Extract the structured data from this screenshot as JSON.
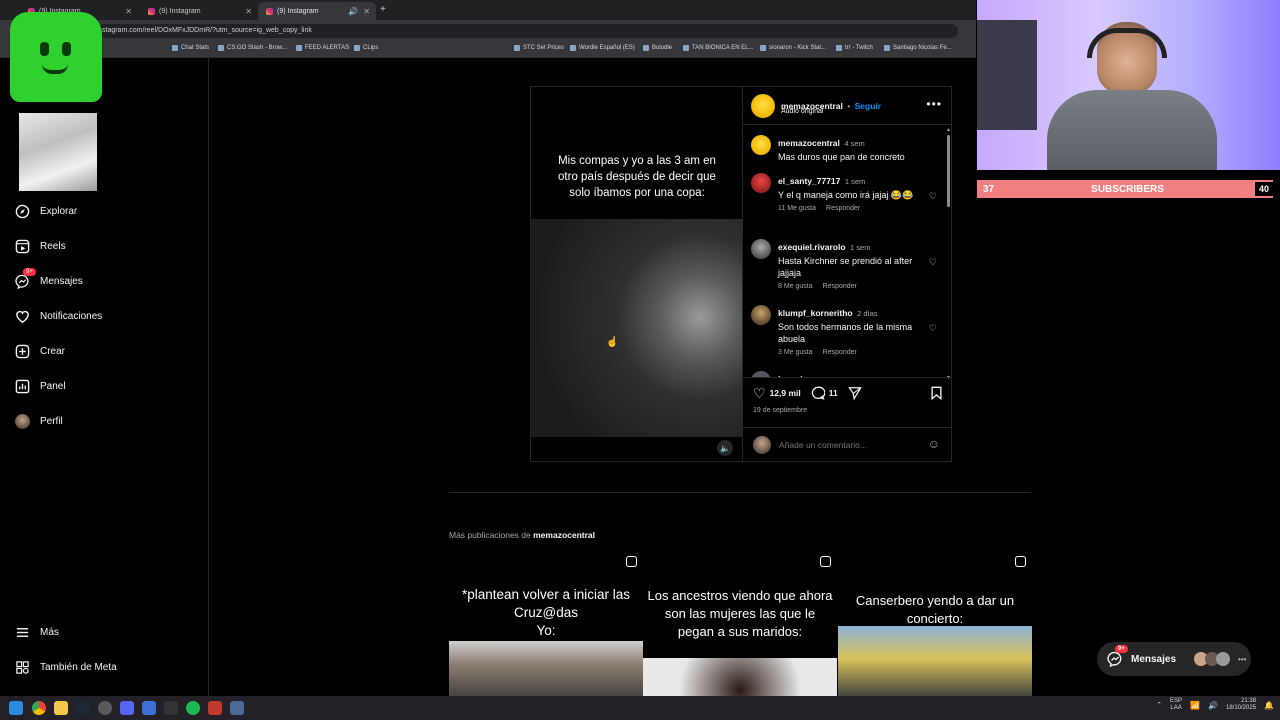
{
  "browser": {
    "tabs": [
      {
        "label": "(9) Instagram"
      },
      {
        "label": "(9) Instagram"
      },
      {
        "label": "(9) Instagram"
      }
    ],
    "url": "stagram.com/reel/DOxMFxJDDmR/?utm_source=ig_web_copy_link",
    "bookmarks": [
      "Chat Stats",
      "CS:GO Stash - Brow...",
      "FEED ALERTAS",
      "CLips",
      "STC Set Prices",
      "Wordle Español (ES)",
      "Boludle",
      "TAN BIONICA EN EL...",
      "sionaron - Kick Stat...",
      "trr - Twitch",
      "Santiago Nicolas Fe..."
    ]
  },
  "sidebar": {
    "items": [
      {
        "label": "Explorar",
        "icon": "compass-icon"
      },
      {
        "label": "Reels",
        "icon": "reels-icon"
      },
      {
        "label": "Mensajes",
        "icon": "messenger-icon",
        "badge": "9+"
      },
      {
        "label": "Notificaciones",
        "icon": "heart-icon"
      },
      {
        "label": "Crear",
        "icon": "plus-square-icon"
      },
      {
        "label": "Panel",
        "icon": "chart-icon"
      },
      {
        "label": "Perfil",
        "icon": "avatar"
      }
    ],
    "bottom": [
      {
        "label": "Más",
        "icon": "menu-icon"
      },
      {
        "label": "También de Meta",
        "icon": "meta-icon"
      }
    ]
  },
  "post": {
    "caption": "Mis compas y yo a las 3 am en otro país después de decir que solo íbamos por una copa:",
    "author": "memazocentral",
    "separator": "•",
    "follow_label": "Seguir",
    "audio": "Audio original",
    "author_comment": {
      "user": "memazocentral",
      "time": "4 sem",
      "text": "Mas duros que pan de concreto"
    },
    "comments": [
      {
        "user": "el_santy_77717",
        "time": "1 sem",
        "text": "Y el q maneja como irá jajaj 😂😂",
        "likes": "11 Me gusta",
        "reply": "Responder"
      },
      {
        "user": "exequiel.rivarolo",
        "time": "1 sem",
        "text": "Hasta Kirchner se prendió al after jajjaja",
        "likes": "8 Me gusta",
        "reply": "Responder"
      },
      {
        "user": "klumpf_korneritho",
        "time": "2 días",
        "text": "Son todos hermanos de la misma abuela",
        "likes": "3 Me gusta",
        "reply": "Responder"
      },
      {
        "user": "lenoxio",
        "time": "",
        "text": "",
        "likes": "",
        "reply": ""
      }
    ],
    "likes_count": "12,9 mil",
    "comments_count": "11",
    "date": "19 de septiembre",
    "comment_placeholder": "Añade un comentario..."
  },
  "more": {
    "title_prefix": "Más publicaciones de",
    "title_user": "memazocentral",
    "items": [
      {
        "text": "*plantean volver a iniciar las Cruz@das\nYo:"
      },
      {
        "text": "Los ancestros viendo que ahora son las mujeres las que le pegan a sus maridos:"
      },
      {
        "text": "Canserbero yendo a dar un concierto:"
      }
    ]
  },
  "stream": {
    "subs_left": "37",
    "subs_label": "SUBSCRIBERS",
    "subs_right": "40"
  },
  "messages_pill": {
    "label": "Mensajes",
    "badge": "9+"
  },
  "taskbar": {
    "lang_top": "ESP",
    "lang_bottom": "LAA",
    "time": "21:38",
    "date": "18/10/2025"
  },
  "colors": {
    "background": "#000000",
    "accent": "#0095f6",
    "badge": "#ff3040",
    "subs_bar": "#f08080",
    "slime": "#2fd12f"
  }
}
